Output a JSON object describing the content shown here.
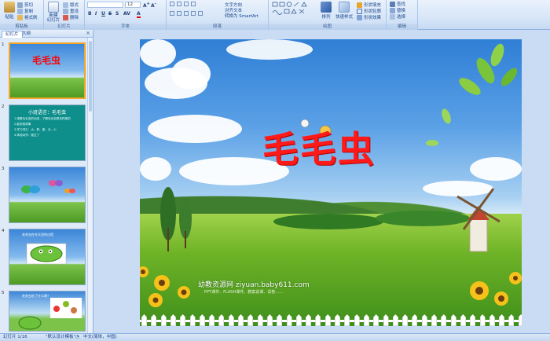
{
  "ribbon": {
    "clipboard": {
      "paste": "粘贴",
      "cut": "剪切",
      "copy": "复制",
      "format_painter": "格式刷",
      "label": "剪贴板"
    },
    "slides": {
      "new_slide": "新建\n幻灯片",
      "layout": "版式",
      "reset": "重设",
      "delete": "删除",
      "label": "幻灯片"
    },
    "font": {
      "font_name": "",
      "font_size": "12",
      "label": "字体"
    },
    "paragraph": {
      "text_direction": "文字方向",
      "align_text": "对齐文本",
      "smartart": "转换为 SmartArt",
      "label": "段落"
    },
    "drawing": {
      "arrange": "排列",
      "quick_styles": "快速样式",
      "fill": "形状填充",
      "outline": "形状轮廓",
      "effects": "形状效果",
      "label": "绘图"
    },
    "editing": {
      "find": "查找",
      "replace": "替换",
      "select": "选择",
      "label": "编辑"
    }
  },
  "pane": {
    "tabs": [
      "幻灯片",
      "大纲"
    ],
    "thumbnails": [
      {
        "num": "1",
        "title": "毛毛虫"
      },
      {
        "num": "2",
        "heading": "小班语言：毛毛虫",
        "lines": [
          "1.观看毛毛虫的动态，了解毛毛虫是怎样爬的",
          "2.能欣赏故事",
          "3.学习词汇：大、胖、瘦、长、小",
          "4.体验动作：爬过了"
        ]
      },
      {
        "num": "3"
      },
      {
        "num": "4",
        "caption": "毛毛虫在冬天里的过程"
      },
      {
        "num": "5",
        "caption": "毛毛虫吃了什么呢？"
      }
    ]
  },
  "slide": {
    "title": "毛毛虫",
    "watermark": "幼教资源网 ziyuan.baby611.com",
    "watermark_sub": "PPT课件、FLASH课件、教案说课、试卷……"
  },
  "status": {
    "slide_counter": "幻灯片 1/16",
    "theme": "\"默认设计模板\"",
    "language": "中文(简体，中国)"
  },
  "colors": {
    "title_red": "#ff1a1a",
    "selection_orange": "#f2a526",
    "ribbon_blue": "#d4e4f7"
  }
}
